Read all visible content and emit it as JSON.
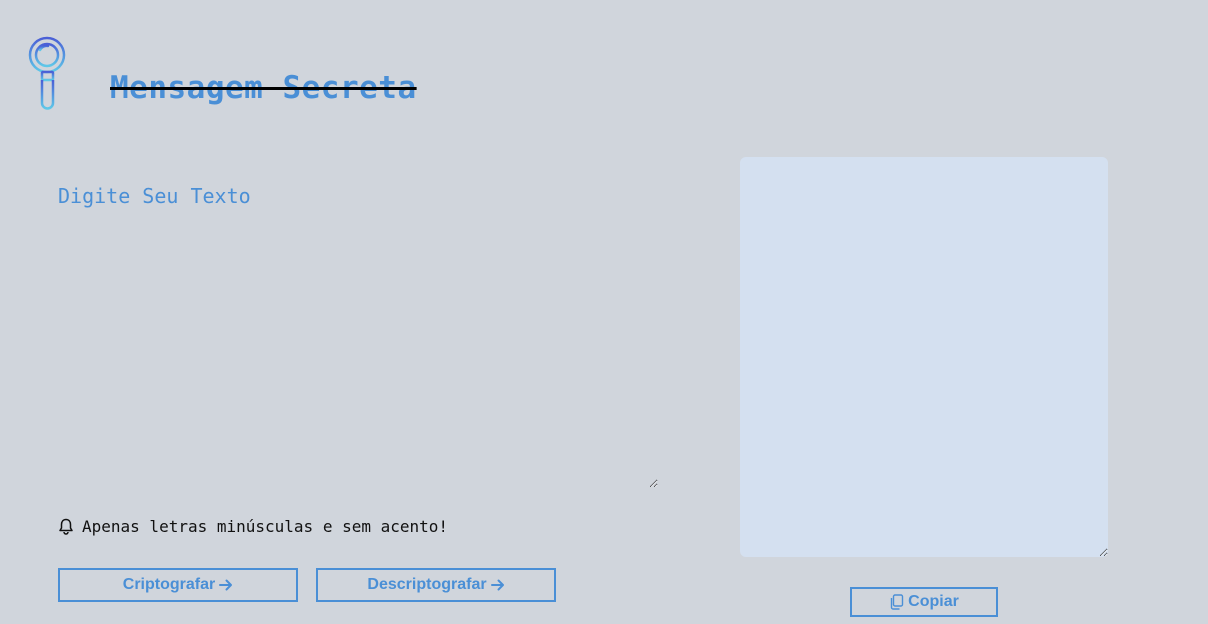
{
  "header": {
    "title": "Mensagem Secreta",
    "logo_icon": "magnifying-glass-icon"
  },
  "input": {
    "placeholder": "Digite Seu Texto",
    "value": ""
  },
  "notice": {
    "icon": "bell-icon",
    "text": "Apenas letras minúsculas e sem acento!"
  },
  "buttons": {
    "encrypt_label": "Criptografar",
    "decrypt_label": "Descriptografar",
    "copy_label": "Copiar",
    "arrow_icon": "arrow-right-icon",
    "copy_icon": "copy-icon"
  },
  "output": {
    "value": ""
  },
  "colors": {
    "background": "#d0d5dc",
    "accent": "#4a8fd6",
    "output_background": "#d4e0f0",
    "logo_gradient_top": "#4a5fd6",
    "logo_gradient_bottom": "#5ec8e8"
  }
}
